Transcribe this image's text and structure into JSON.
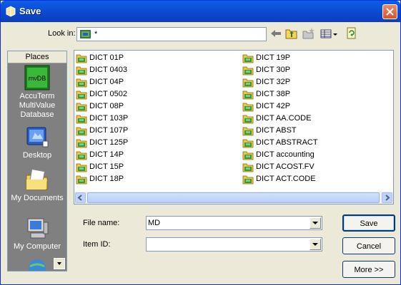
{
  "window": {
    "title": "Save"
  },
  "lookin": {
    "label": "Look in:",
    "value": "*"
  },
  "places": {
    "header": "Places",
    "items": [
      {
        "icon_text": "mvDB",
        "label": "AccuTerm MultiValue Database"
      },
      {
        "label": "Desktop"
      },
      {
        "label": "My Documents"
      },
      {
        "label": "My Computer"
      }
    ]
  },
  "files": {
    "col1": [
      "DICT 01P",
      "DICT 0403",
      "DICT 04P",
      "DICT 0502",
      "DICT 08P",
      "DICT 103P",
      "DICT 107P",
      "DICT 125P",
      "DICT 14P",
      "DICT 15P",
      "DICT 18P"
    ],
    "col2": [
      "DICT 19P",
      "DICT 30P",
      "DICT 32P",
      "DICT 38P",
      "DICT 42P",
      "DICT AA.CODE",
      "DICT ABST",
      "DICT ABSTRACT",
      "DICT accounting",
      "DICT ACOST.FV",
      "DICT ACT.CODE"
    ]
  },
  "form": {
    "filename_label": "File name:",
    "filename_value": "MD",
    "itemid_label": "Item ID:",
    "itemid_value": ""
  },
  "buttons": {
    "save": "Save",
    "cancel": "Cancel",
    "more": "More >>"
  }
}
